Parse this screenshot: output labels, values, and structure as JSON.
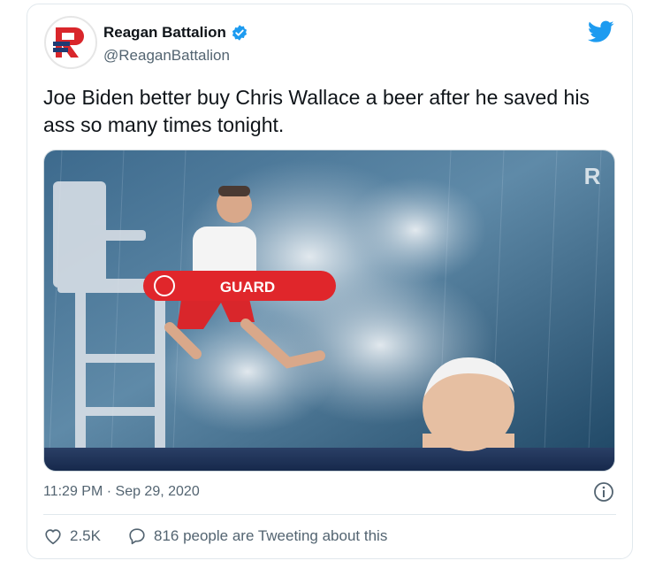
{
  "tweet": {
    "author": {
      "display_name": "Reagan Battalion",
      "handle": "@ReaganBattalion",
      "verified": true,
      "avatar_icon": "reagan-battalion-logo"
    },
    "platform_icon": "twitter-bird-icon",
    "text": "Joe Biden better buy Chris Wallace a beer after he saved his ass so many times tonight.",
    "media": {
      "type": "image",
      "buoy_text": "GUARD",
      "watermark": "R"
    },
    "timestamp": "11:29 PM · Sep 29, 2020",
    "likes": "2.5K",
    "conversation": "816 people are Tweeting about this"
  },
  "colors": {
    "twitter_blue": "#1d9bf0",
    "brand_red": "#d9262b",
    "brand_navy": "#1f3b73",
    "muted_text": "#536471"
  }
}
